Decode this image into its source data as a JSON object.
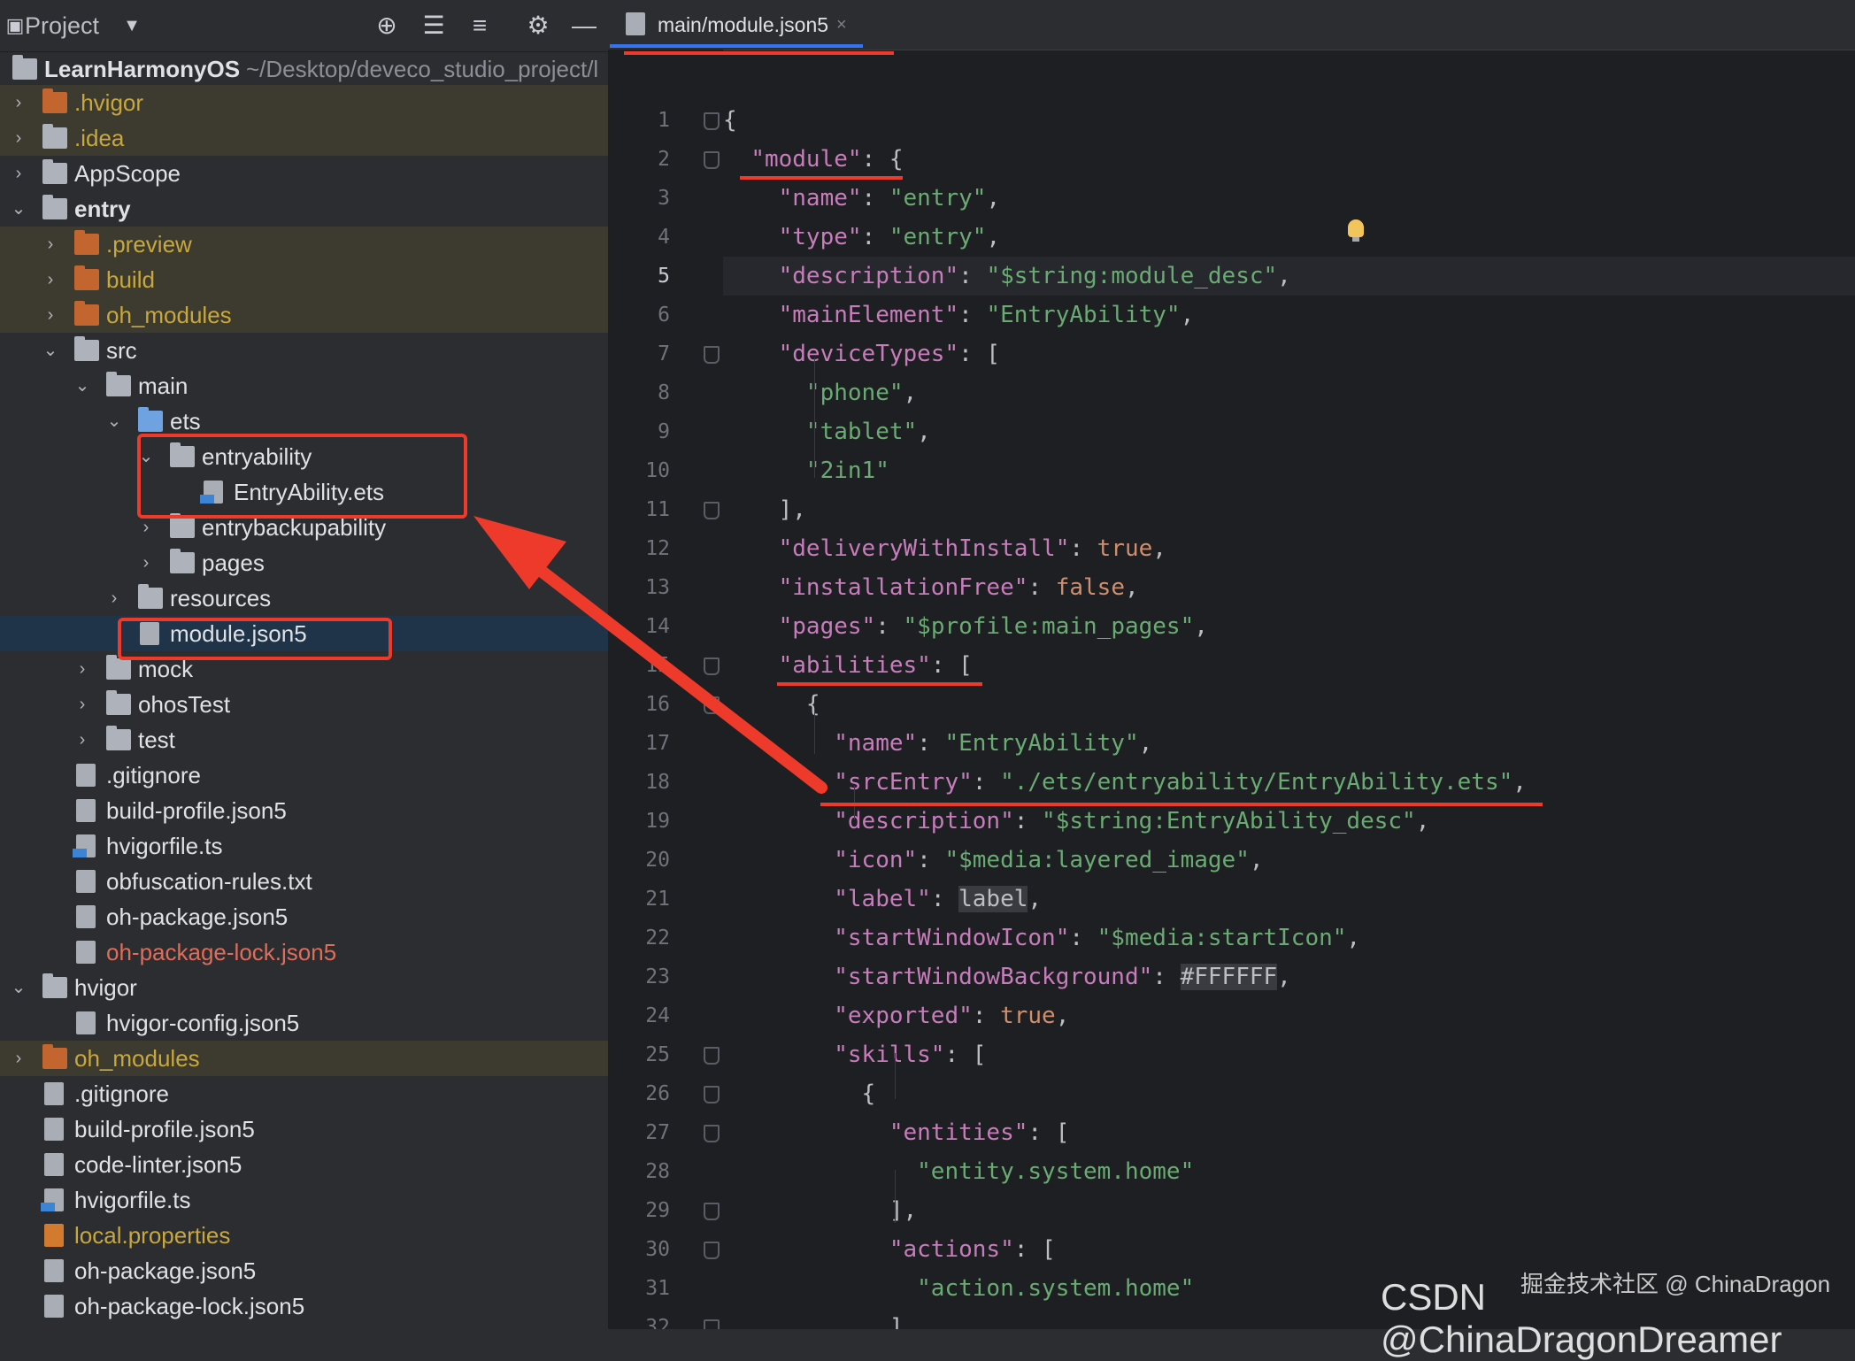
{
  "left_panel": {
    "title": "Project",
    "dropdown_icon": "chevron-down-icon",
    "toolbar_icons": [
      "crosshair-icon",
      "expand-all-icon",
      "collapse-all-icon",
      "gear-icon",
      "minimize-icon"
    ],
    "root": {
      "name": "LearnHarmonyOS",
      "path": "~/Desktop/deveco_studio_project/l"
    },
    "items": [
      {
        "label": ".hvigor",
        "type": "folder",
        "color": "orange",
        "status": "ignored",
        "expanded": false
      },
      {
        "label": ".idea",
        "type": "folder",
        "color": "gray",
        "status": "ignored",
        "expanded": false
      },
      {
        "label": "AppScope",
        "type": "folder",
        "color": "gray",
        "status": "normal",
        "expanded": false
      },
      {
        "label": "entry",
        "type": "folder",
        "color": "gray",
        "status": "normal",
        "expanded": true
      },
      {
        "label": ".preview",
        "type": "folder",
        "color": "orange",
        "status": "ignored",
        "expanded": false
      },
      {
        "label": "build",
        "type": "folder",
        "color": "orange",
        "status": "ignored",
        "expanded": false
      },
      {
        "label": "oh_modules",
        "type": "folder",
        "color": "orange",
        "status": "ignored",
        "expanded": false
      },
      {
        "label": "src",
        "type": "folder",
        "color": "gray",
        "status": "normal",
        "expanded": true
      },
      {
        "label": "main",
        "type": "folder",
        "color": "gray",
        "status": "normal",
        "expanded": true
      },
      {
        "label": "ets",
        "type": "folder",
        "color": "blue",
        "status": "normal",
        "expanded": true
      },
      {
        "label": "entryability",
        "type": "folder",
        "color": "gray",
        "status": "normal",
        "expanded": true
      },
      {
        "label": "EntryAbility.ets",
        "type": "file-ets",
        "status": "normal"
      },
      {
        "label": "entrybackupability",
        "type": "folder",
        "color": "gray",
        "status": "normal",
        "expanded": false
      },
      {
        "label": "pages",
        "type": "folder",
        "color": "gray",
        "status": "normal",
        "expanded": false
      },
      {
        "label": "resources",
        "type": "folder",
        "color": "gray",
        "status": "normal",
        "expanded": false
      },
      {
        "label": "module.json5",
        "type": "file-json",
        "status": "selected"
      },
      {
        "label": "mock",
        "type": "folder",
        "color": "gray",
        "status": "normal",
        "expanded": false
      },
      {
        "label": "ohosTest",
        "type": "folder",
        "color": "gray",
        "status": "normal",
        "expanded": false
      },
      {
        "label": "test",
        "type": "folder",
        "color": "gray",
        "status": "normal",
        "expanded": false
      },
      {
        "label": ".gitignore",
        "type": "file-git",
        "status": "normal"
      },
      {
        "label": "build-profile.json5",
        "type": "file-json",
        "status": "normal"
      },
      {
        "label": "hvigorfile.ts",
        "type": "file-ts",
        "status": "normal"
      },
      {
        "label": "obfuscation-rules.txt",
        "type": "file-txt",
        "status": "normal"
      },
      {
        "label": "oh-package.json5",
        "type": "file-json",
        "status": "normal"
      },
      {
        "label": "oh-package-lock.json5",
        "type": "file-json",
        "status": "changed"
      },
      {
        "label": "hvigor",
        "type": "folder",
        "color": "gray",
        "status": "normal",
        "expanded": true
      },
      {
        "label": "hvigor-config.json5",
        "type": "file-json",
        "status": "normal"
      },
      {
        "label": "oh_modules",
        "type": "folder",
        "color": "orange",
        "status": "ignored",
        "expanded": false
      },
      {
        "label": ".gitignore",
        "type": "file-git",
        "status": "normal"
      },
      {
        "label": "build-profile.json5",
        "type": "file-json",
        "status": "normal"
      },
      {
        "label": "code-linter.json5",
        "type": "file-json",
        "status": "normal"
      },
      {
        "label": "hvigorfile.ts",
        "type": "file-ts",
        "status": "normal"
      },
      {
        "label": "local.properties",
        "type": "file-properties",
        "status": "ignored"
      },
      {
        "label": "oh-package.json5",
        "type": "file-json",
        "status": "normal"
      },
      {
        "label": "oh-package-lock.json5",
        "type": "file-json",
        "status": "normal"
      }
    ]
  },
  "editor": {
    "tab": {
      "label": "main/module.json5",
      "close": "×"
    },
    "current_line": 5,
    "lines": [
      {
        "n": "1",
        "t": [
          [
            "p",
            "{"
          ]
        ]
      },
      {
        "n": "2",
        "t": [
          [
            "p",
            "  "
          ],
          [
            "k",
            "\"module\""
          ],
          [
            "p",
            ": {"
          ]
        ]
      },
      {
        "n": "3",
        "t": [
          [
            "p",
            "    "
          ],
          [
            "k",
            "\"name\""
          ],
          [
            "p",
            ": "
          ],
          [
            "s",
            "\"entry\""
          ],
          [
            "p",
            ","
          ]
        ]
      },
      {
        "n": "4",
        "t": [
          [
            "p",
            "    "
          ],
          [
            "k",
            "\"type\""
          ],
          [
            "p",
            ": "
          ],
          [
            "s",
            "\"entry\""
          ],
          [
            "p",
            ","
          ]
        ]
      },
      {
        "n": "5",
        "t": [
          [
            "p",
            "    "
          ],
          [
            "k",
            "\"description\""
          ],
          [
            "p",
            ": "
          ],
          [
            "s",
            "\"$string:module_desc\""
          ],
          [
            "p",
            ","
          ]
        ]
      },
      {
        "n": "6",
        "t": [
          [
            "p",
            "    "
          ],
          [
            "k",
            "\"mainElement\""
          ],
          [
            "p",
            ": "
          ],
          [
            "s",
            "\"EntryAbility\""
          ],
          [
            "p",
            ","
          ]
        ]
      },
      {
        "n": "7",
        "t": [
          [
            "p",
            "    "
          ],
          [
            "k",
            "\"deviceTypes\""
          ],
          [
            "p",
            ": ["
          ]
        ]
      },
      {
        "n": "8",
        "t": [
          [
            "p",
            "      "
          ],
          [
            "s",
            "\"phone\""
          ],
          [
            "p",
            ","
          ]
        ]
      },
      {
        "n": "9",
        "t": [
          [
            "p",
            "      "
          ],
          [
            "s",
            "\"tablet\""
          ],
          [
            "p",
            ","
          ]
        ]
      },
      {
        "n": "10",
        "t": [
          [
            "p",
            "      "
          ],
          [
            "s",
            "\"2in1\""
          ]
        ]
      },
      {
        "n": "11",
        "t": [
          [
            "p",
            "    ],"
          ]
        ]
      },
      {
        "n": "12",
        "t": [
          [
            "p",
            "    "
          ],
          [
            "k",
            "\"deliveryWithInstall\""
          ],
          [
            "p",
            ": "
          ],
          [
            "c",
            "true"
          ],
          [
            "p",
            ","
          ]
        ]
      },
      {
        "n": "13",
        "t": [
          [
            "p",
            "    "
          ],
          [
            "k",
            "\"installationFree\""
          ],
          [
            "p",
            ": "
          ],
          [
            "c",
            "false"
          ],
          [
            "p",
            ","
          ]
        ]
      },
      {
        "n": "14",
        "t": [
          [
            "p",
            "    "
          ],
          [
            "k",
            "\"pages\""
          ],
          [
            "p",
            ": "
          ],
          [
            "s",
            "\"$profile:main_pages\""
          ],
          [
            "p",
            ","
          ]
        ]
      },
      {
        "n": "15",
        "t": [
          [
            "p",
            "    "
          ],
          [
            "k",
            "\"abilities\""
          ],
          [
            "p",
            ": ["
          ]
        ]
      },
      {
        "n": "16",
        "t": [
          [
            "p",
            "      {"
          ]
        ]
      },
      {
        "n": "17",
        "t": [
          [
            "p",
            "        "
          ],
          [
            "k",
            "\"name\""
          ],
          [
            "p",
            ": "
          ],
          [
            "s",
            "\"EntryAbility\""
          ],
          [
            "p",
            ","
          ]
        ]
      },
      {
        "n": "18",
        "t": [
          [
            "p",
            "        "
          ],
          [
            "k",
            "\"srcEntry\""
          ],
          [
            "p",
            ": "
          ],
          [
            "s",
            "\"./ets/entryability/EntryAbility.ets\""
          ],
          [
            "p",
            ","
          ]
        ]
      },
      {
        "n": "19",
        "t": [
          [
            "p",
            "        "
          ],
          [
            "k",
            "\"description\""
          ],
          [
            "p",
            ": "
          ],
          [
            "s",
            "\"$string:EntryAbility_desc\""
          ],
          [
            "p",
            ","
          ]
        ]
      },
      {
        "n": "20",
        "t": [
          [
            "p",
            "        "
          ],
          [
            "k",
            "\"icon\""
          ],
          [
            "p",
            ": "
          ],
          [
            "s",
            "\"$media:layered_image\""
          ],
          [
            "p",
            ","
          ]
        ]
      },
      {
        "n": "21",
        "t": [
          [
            "p",
            "        "
          ],
          [
            "k",
            "\"label\""
          ],
          [
            "p",
            ": "
          ],
          [
            "box",
            "label"
          ],
          [
            "p",
            ","
          ]
        ]
      },
      {
        "n": "22",
        "t": [
          [
            "p",
            "        "
          ],
          [
            "k",
            "\"startWindowIcon\""
          ],
          [
            "p",
            ": "
          ],
          [
            "s",
            "\"$media:startIcon\""
          ],
          [
            "p",
            ","
          ]
        ]
      },
      {
        "n": "23",
        "t": [
          [
            "p",
            "        "
          ],
          [
            "k",
            "\"startWindowBackground\""
          ],
          [
            "p",
            ": "
          ],
          [
            "box",
            "#FFFFFF"
          ],
          [
            "p",
            ","
          ]
        ]
      },
      {
        "n": "24",
        "t": [
          [
            "p",
            "        "
          ],
          [
            "k",
            "\"exported\""
          ],
          [
            "p",
            ": "
          ],
          [
            "c",
            "true"
          ],
          [
            "p",
            ","
          ]
        ]
      },
      {
        "n": "25",
        "t": [
          [
            "p",
            "        "
          ],
          [
            "k",
            "\"skills\""
          ],
          [
            "p",
            ": ["
          ]
        ]
      },
      {
        "n": "26",
        "t": [
          [
            "p",
            "          {"
          ]
        ]
      },
      {
        "n": "27",
        "t": [
          [
            "p",
            "            "
          ],
          [
            "k",
            "\"entities\""
          ],
          [
            "p",
            ": ["
          ]
        ]
      },
      {
        "n": "28",
        "t": [
          [
            "p",
            "              "
          ],
          [
            "s",
            "\"entity.system.home\""
          ]
        ]
      },
      {
        "n": "29",
        "t": [
          [
            "p",
            "            ],"
          ]
        ]
      },
      {
        "n": "30",
        "t": [
          [
            "p",
            "            "
          ],
          [
            "k",
            "\"actions\""
          ],
          [
            "p",
            ": ["
          ]
        ]
      },
      {
        "n": "31",
        "t": [
          [
            "p",
            "              "
          ],
          [
            "s",
            "\"action.system.home\""
          ]
        ]
      },
      {
        "n": "32",
        "t": [
          [
            "p",
            "            ]"
          ]
        ]
      }
    ],
    "fold_lines": [
      1,
      2,
      7,
      11,
      15,
      16,
      25,
      26,
      27,
      29,
      30,
      32
    ],
    "bulb_icon": "lightbulb-icon"
  },
  "watermark": {
    "line1": "掘金技术社区 @ ChinaDragon",
    "line2": "CSDN @ChinaDragonDreamer"
  },
  "colors": {
    "annotation": "#ee3a2a",
    "key": "#c77dbb",
    "string": "#6aab73",
    "constant": "#cf8e6d"
  }
}
